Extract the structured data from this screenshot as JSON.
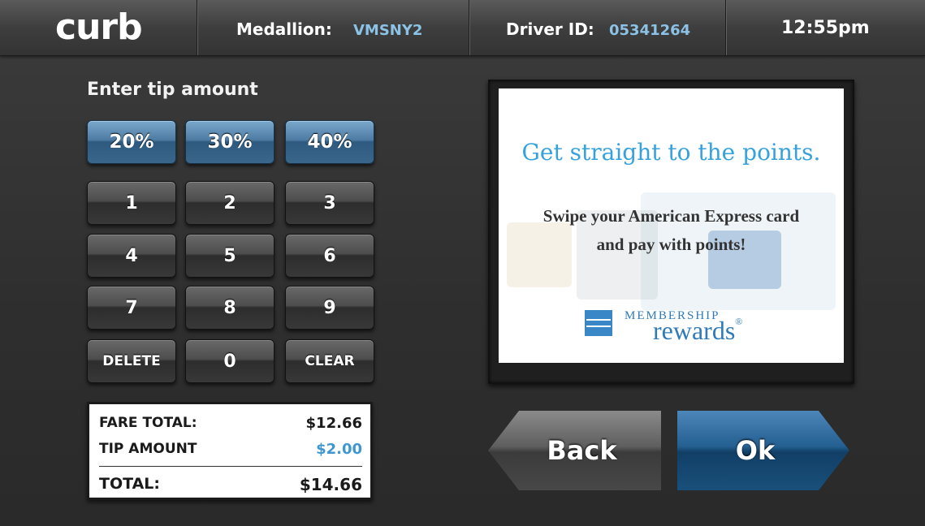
{
  "header": {
    "logo": "curb",
    "medallion_label": "Medallion:",
    "medallion_value": "VMSNY2",
    "driver_label": "Driver ID:",
    "driver_value": "05341264",
    "time": "12:55pm"
  },
  "tip": {
    "prompt": "Enter tip amount",
    "percent_buttons": [
      "20%",
      "30%",
      "40%"
    ],
    "keys": [
      "1",
      "2",
      "3",
      "4",
      "5",
      "6",
      "7",
      "8",
      "9"
    ],
    "delete_label": "DELETE",
    "zero_label": "0",
    "clear_label": "CLEAR"
  },
  "summary": {
    "fare_label": "FARE TOTAL:",
    "fare_value": "$12.66",
    "tip_label": "TIP AMOUNT",
    "tip_value": "$2.00",
    "total_label": "TOTAL:",
    "total_value": "$14.66"
  },
  "ad": {
    "headline": "Get straight to the points.",
    "body_line1": "Swipe your American Express card",
    "body_line2": "and pay with points!",
    "brand_top": "MEMBERSHIP",
    "brand_bottom": "rewards",
    "brand_mark": "®"
  },
  "actions": {
    "back_label": "Back",
    "ok_label": "Ok"
  },
  "colors": {
    "accent_blue": "#3f97cf",
    "header_value_blue": "#8cc2e6",
    "ok_button_blue": "#245f91"
  }
}
